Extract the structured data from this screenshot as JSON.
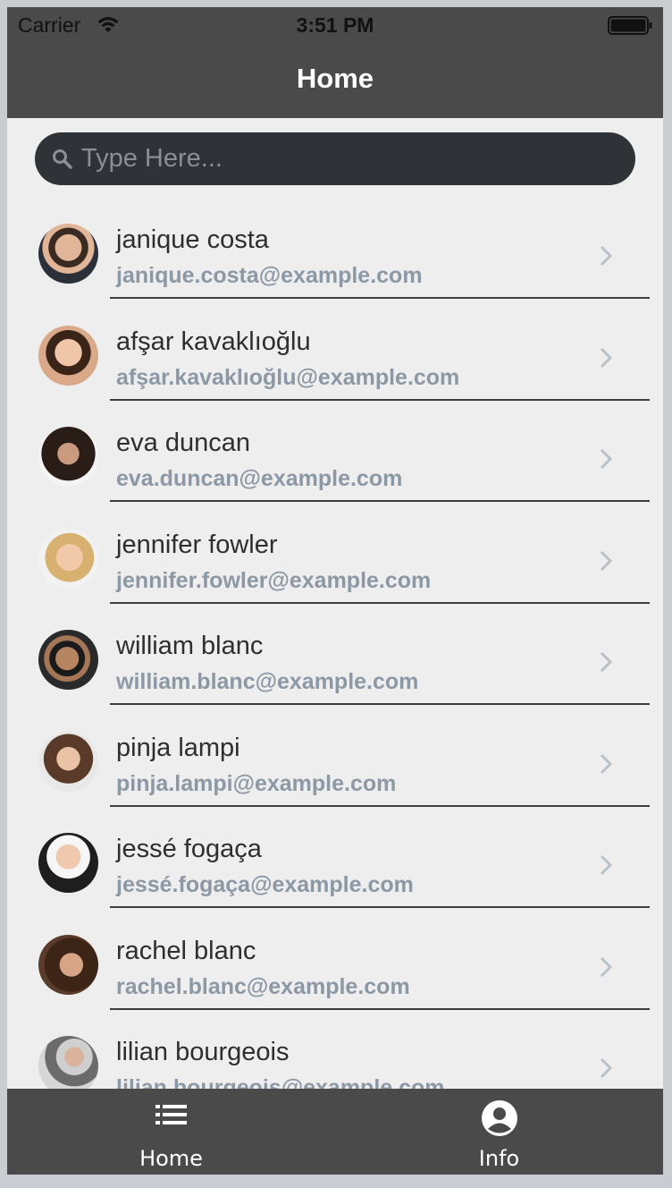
{
  "status_bar": {
    "carrier": "Carrier",
    "time": "3:51 PM"
  },
  "header": {
    "title": "Home"
  },
  "search": {
    "placeholder": "Type Here..."
  },
  "contacts": [
    {
      "name": "janique costa",
      "email": "janique.costa@example.com"
    },
    {
      "name": "afşar kavaklıoğlu",
      "email": "afşar.kavaklıoğlu@example.com"
    },
    {
      "name": "eva duncan",
      "email": "eva.duncan@example.com"
    },
    {
      "name": "jennifer fowler",
      "email": "jennifer.fowler@example.com"
    },
    {
      "name": "william blanc",
      "email": "william.blanc@example.com"
    },
    {
      "name": "pinja lampi",
      "email": "pinja.lampi@example.com"
    },
    {
      "name": "jessé fogaça",
      "email": "jessé.fogaça@example.com"
    },
    {
      "name": "rachel blanc",
      "email": "rachel.blanc@example.com"
    },
    {
      "name": "lilian bourgeois",
      "email": "lilian.bourgeois@example.com"
    }
  ],
  "tabbar": {
    "tabs": [
      {
        "label": "Home",
        "icon": "list-icon"
      },
      {
        "label": "Info",
        "icon": "account-circle-icon"
      }
    ]
  },
  "colors": {
    "header_bg": "#4a4a4a",
    "list_bg": "#eeeeee",
    "email_text": "#8d98a5",
    "search_bg": "#2f3236"
  }
}
